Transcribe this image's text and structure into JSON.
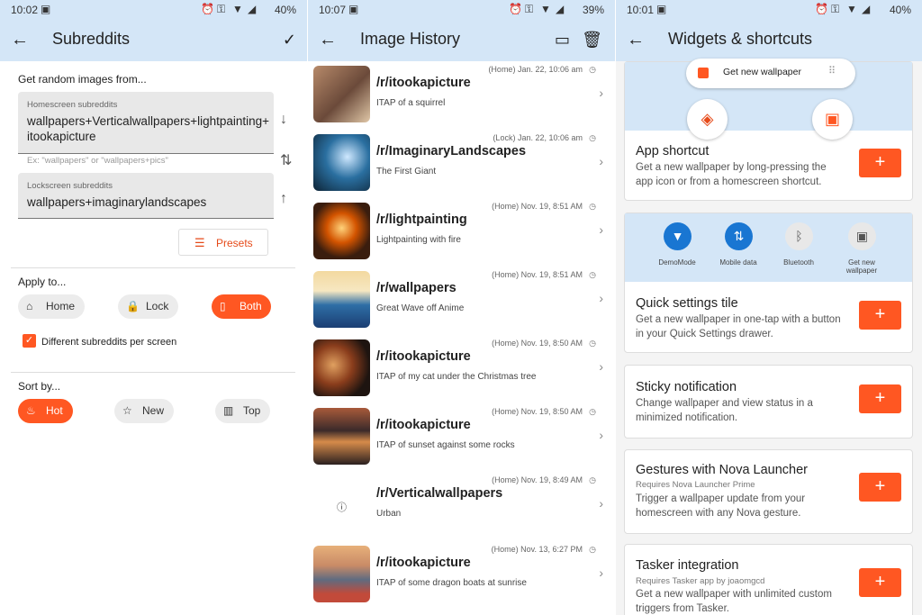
{
  "colors": {
    "accent": "#ff5722",
    "appbar": "#d4e6f7",
    "chip": "#ececec"
  },
  "panel1": {
    "status": {
      "time": "10:02",
      "battery": "40%"
    },
    "title": "Subreddits",
    "intro": "Get random images from...",
    "home_field": {
      "label": "Homescreen subreddits",
      "value": "wallpapers+Verticalwallpapers+lightpainting+itookapicture"
    },
    "hint": "Ex: \"wallpapers\" or \"wallpapers+pics\"",
    "lock_field": {
      "label": "Lockscreen subreddits",
      "value": "wallpapers+imaginarylandscapes"
    },
    "presets": "Presets",
    "apply_label": "Apply to...",
    "apply": [
      "Home",
      "Lock",
      "Both"
    ],
    "checkbox": "Different subreddits per screen",
    "sort_label": "Sort by...",
    "sort": [
      "Hot",
      "New",
      "Top"
    ]
  },
  "panel2": {
    "status": {
      "time": "10:07",
      "battery": "39%"
    },
    "title": "Image History",
    "items": [
      {
        "sub": "/r/itookapicture",
        "desc": "ITAP of a squirrel",
        "date": "(Home) Jan. 22, 10:06 am"
      },
      {
        "sub": "/r/ImaginaryLandscapes",
        "desc": "The First Giant",
        "date": "(Lock) Jan. 22, 10:06 am"
      },
      {
        "sub": "/r/lightpainting",
        "desc": "Lightpainting with fire",
        "date": "(Home) Nov. 19, 8:51 AM"
      },
      {
        "sub": "/r/wallpapers",
        "desc": "Great Wave off Anime",
        "date": "(Home) Nov. 19, 8:51 AM"
      },
      {
        "sub": "/r/itookapicture",
        "desc": "ITAP of my cat under the Christmas tree",
        "date": "(Home) Nov. 19, 8:50 AM"
      },
      {
        "sub": "/r/itookapicture",
        "desc": "ITAP of sunset against some rocks",
        "date": "(Home) Nov. 19, 8:50 AM"
      },
      {
        "sub": "/r/Verticalwallpapers",
        "desc": "Urban",
        "date": "(Home) Nov. 19, 8:49 AM"
      },
      {
        "sub": "/r/itookapicture",
        "desc": "ITAP of some dragon boats at sunrise",
        "date": "(Home) Nov. 13, 6:27 PM"
      }
    ]
  },
  "panel3": {
    "status": {
      "time": "10:01",
      "battery": "40%"
    },
    "title": "Widgets & shortcuts",
    "preview_shortcut": "Get new wallpaper",
    "qs_tiles": [
      "DemoMode",
      "Mobile data",
      "Bluetooth",
      "Get new wallpaper"
    ],
    "cards": [
      {
        "title": "App shortcut",
        "req": "",
        "desc": "Get a new wallpaper by long-pressing the app icon or from a homescreen shortcut."
      },
      {
        "title": "Quick settings tile",
        "req": "",
        "desc": "Get a new wallpaper in one-tap with a button in your Quick Settings drawer."
      },
      {
        "title": "Sticky notification",
        "req": "",
        "desc": "Change wallpaper and view status in a minimized notification."
      },
      {
        "title": "Gestures with Nova Launcher",
        "req": "Requires Nova Launcher Prime",
        "desc": "Trigger a wallpaper update from your homescreen with any Nova gesture."
      },
      {
        "title": "Tasker integration",
        "req": "Requires Tasker app by joaomgcd",
        "desc": "Get a new wallpaper with unlimited custom triggers from Tasker."
      }
    ]
  }
}
